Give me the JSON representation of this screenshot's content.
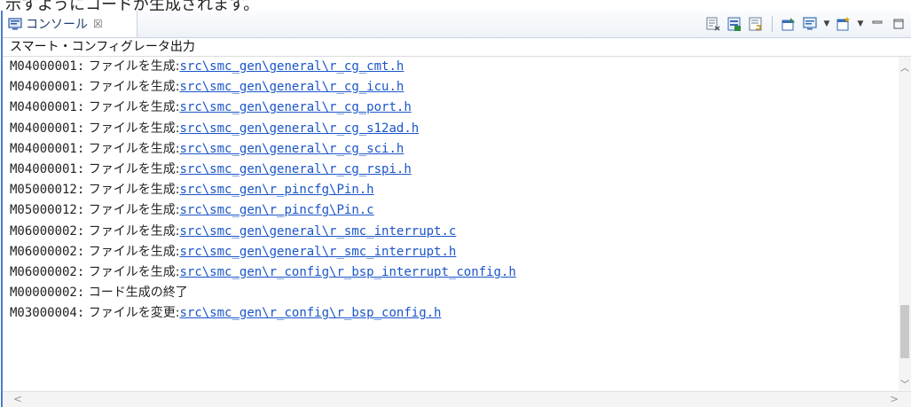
{
  "caption": "示すようにコードが生成されます。",
  "tab": {
    "label": "コンソール",
    "close_glyph": "☒"
  },
  "toolbar": {
    "icons": [
      "clear-console",
      "scroll-lock",
      "word-wrap",
      "pin-console",
      "display-selected-console",
      "open-console"
    ]
  },
  "header": "スマート・コンフィグレータ出力",
  "lines": [
    {
      "code": "M04000001:",
      "msg": " ファイルを生成:",
      "link": "src\\smc_gen\\general\\r_cg_cmt.h"
    },
    {
      "code": "M04000001:",
      "msg": " ファイルを生成:",
      "link": "src\\smc_gen\\general\\r_cg_icu.h"
    },
    {
      "code": "M04000001:",
      "msg": " ファイルを生成:",
      "link": "src\\smc_gen\\general\\r_cg_port.h"
    },
    {
      "code": "M04000001:",
      "msg": " ファイルを生成:",
      "link": "src\\smc_gen\\general\\r_cg_s12ad.h"
    },
    {
      "code": "M04000001:",
      "msg": " ファイルを生成:",
      "link": "src\\smc_gen\\general\\r_cg_sci.h"
    },
    {
      "code": "M04000001:",
      "msg": " ファイルを生成:",
      "link": "src\\smc_gen\\general\\r_cg_rspi.h"
    },
    {
      "code": "M05000012:",
      "msg": " ファイルを生成:",
      "link": "src\\smc_gen\\r_pincfg\\Pin.h"
    },
    {
      "code": "M05000012:",
      "msg": " ファイルを生成:",
      "link": "src\\smc_gen\\r_pincfg\\Pin.c"
    },
    {
      "code": "M06000002:",
      "msg": " ファイルを生成:",
      "link": "src\\smc_gen\\general\\r_smc_interrupt.c"
    },
    {
      "code": "M06000002:",
      "msg": " ファイルを生成:",
      "link": "src\\smc_gen\\general\\r_smc_interrupt.h"
    },
    {
      "code": "M06000002:",
      "msg": " ファイルを生成:",
      "link": "src\\smc_gen\\r_config\\r_bsp_interrupt_config.h"
    },
    {
      "code": "M00000002:",
      "msg": " コード生成の終了",
      "link": ""
    },
    {
      "code": "M03000004:",
      "msg": " ファイルを変更:",
      "link": "src\\smc_gen\\r_config\\r_bsp_config.h"
    }
  ]
}
